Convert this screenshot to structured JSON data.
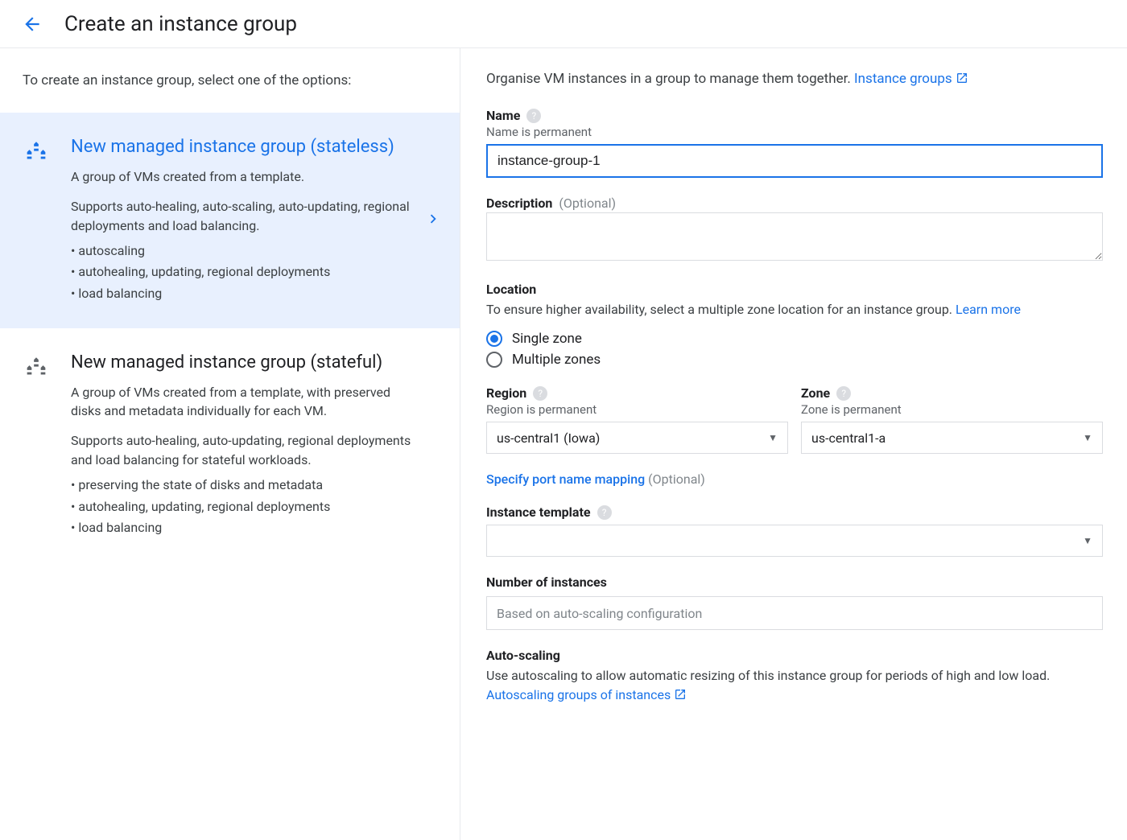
{
  "header": {
    "title": "Create an instance group"
  },
  "sidebar": {
    "intro": "To create an instance group, select one of the options:",
    "options": [
      {
        "title": "New managed instance group (stateless)",
        "desc": "A group of VMs created from a template.",
        "supports": "Supports auto-healing, auto-scaling, auto-updating, regional deployments and load balancing.",
        "bullets": [
          "autoscaling",
          "autohealing, updating, regional deployments",
          "load balancing"
        ]
      },
      {
        "title": "New managed instance group (stateful)",
        "desc": "A group of VMs created from a template, with preserved disks and metadata individually for each VM.",
        "supports": "Supports auto-healing, auto-updating, regional deployments and load balancing for stateful workloads.",
        "bullets": [
          "preserving the state of disks and metadata",
          "autohealing, updating, regional deployments",
          "load balancing"
        ]
      }
    ]
  },
  "main": {
    "intro_text": "Organise VM instances in a group to manage them together. ",
    "intro_link": "Instance groups",
    "name": {
      "label": "Name",
      "sub": "Name is permanent",
      "value": "instance-group-1"
    },
    "description": {
      "label": "Description",
      "optional": "(Optional)",
      "value": ""
    },
    "location": {
      "label": "Location",
      "desc": "To ensure higher availability, select a multiple zone location for an instance group. ",
      "learn_more": "Learn more",
      "radio_single": "Single zone",
      "radio_multiple": "Multiple zones"
    },
    "region": {
      "label": "Region",
      "sub": "Region is permanent",
      "value": "us-central1 (Iowa)"
    },
    "zone": {
      "label": "Zone",
      "sub": "Zone is permanent",
      "value": "us-central1-a"
    },
    "port_mapping": {
      "link": "Specify port name mapping",
      "optional": "(Optional)"
    },
    "instance_template": {
      "label": "Instance template",
      "value": ""
    },
    "num_instances": {
      "label": "Number of instances",
      "placeholder": "Based on auto-scaling configuration"
    },
    "autoscaling": {
      "label": "Auto-scaling",
      "desc": "Use autoscaling to allow automatic resizing of this instance group for periods of high and low load. ",
      "link": "Autoscaling groups of instances"
    }
  }
}
